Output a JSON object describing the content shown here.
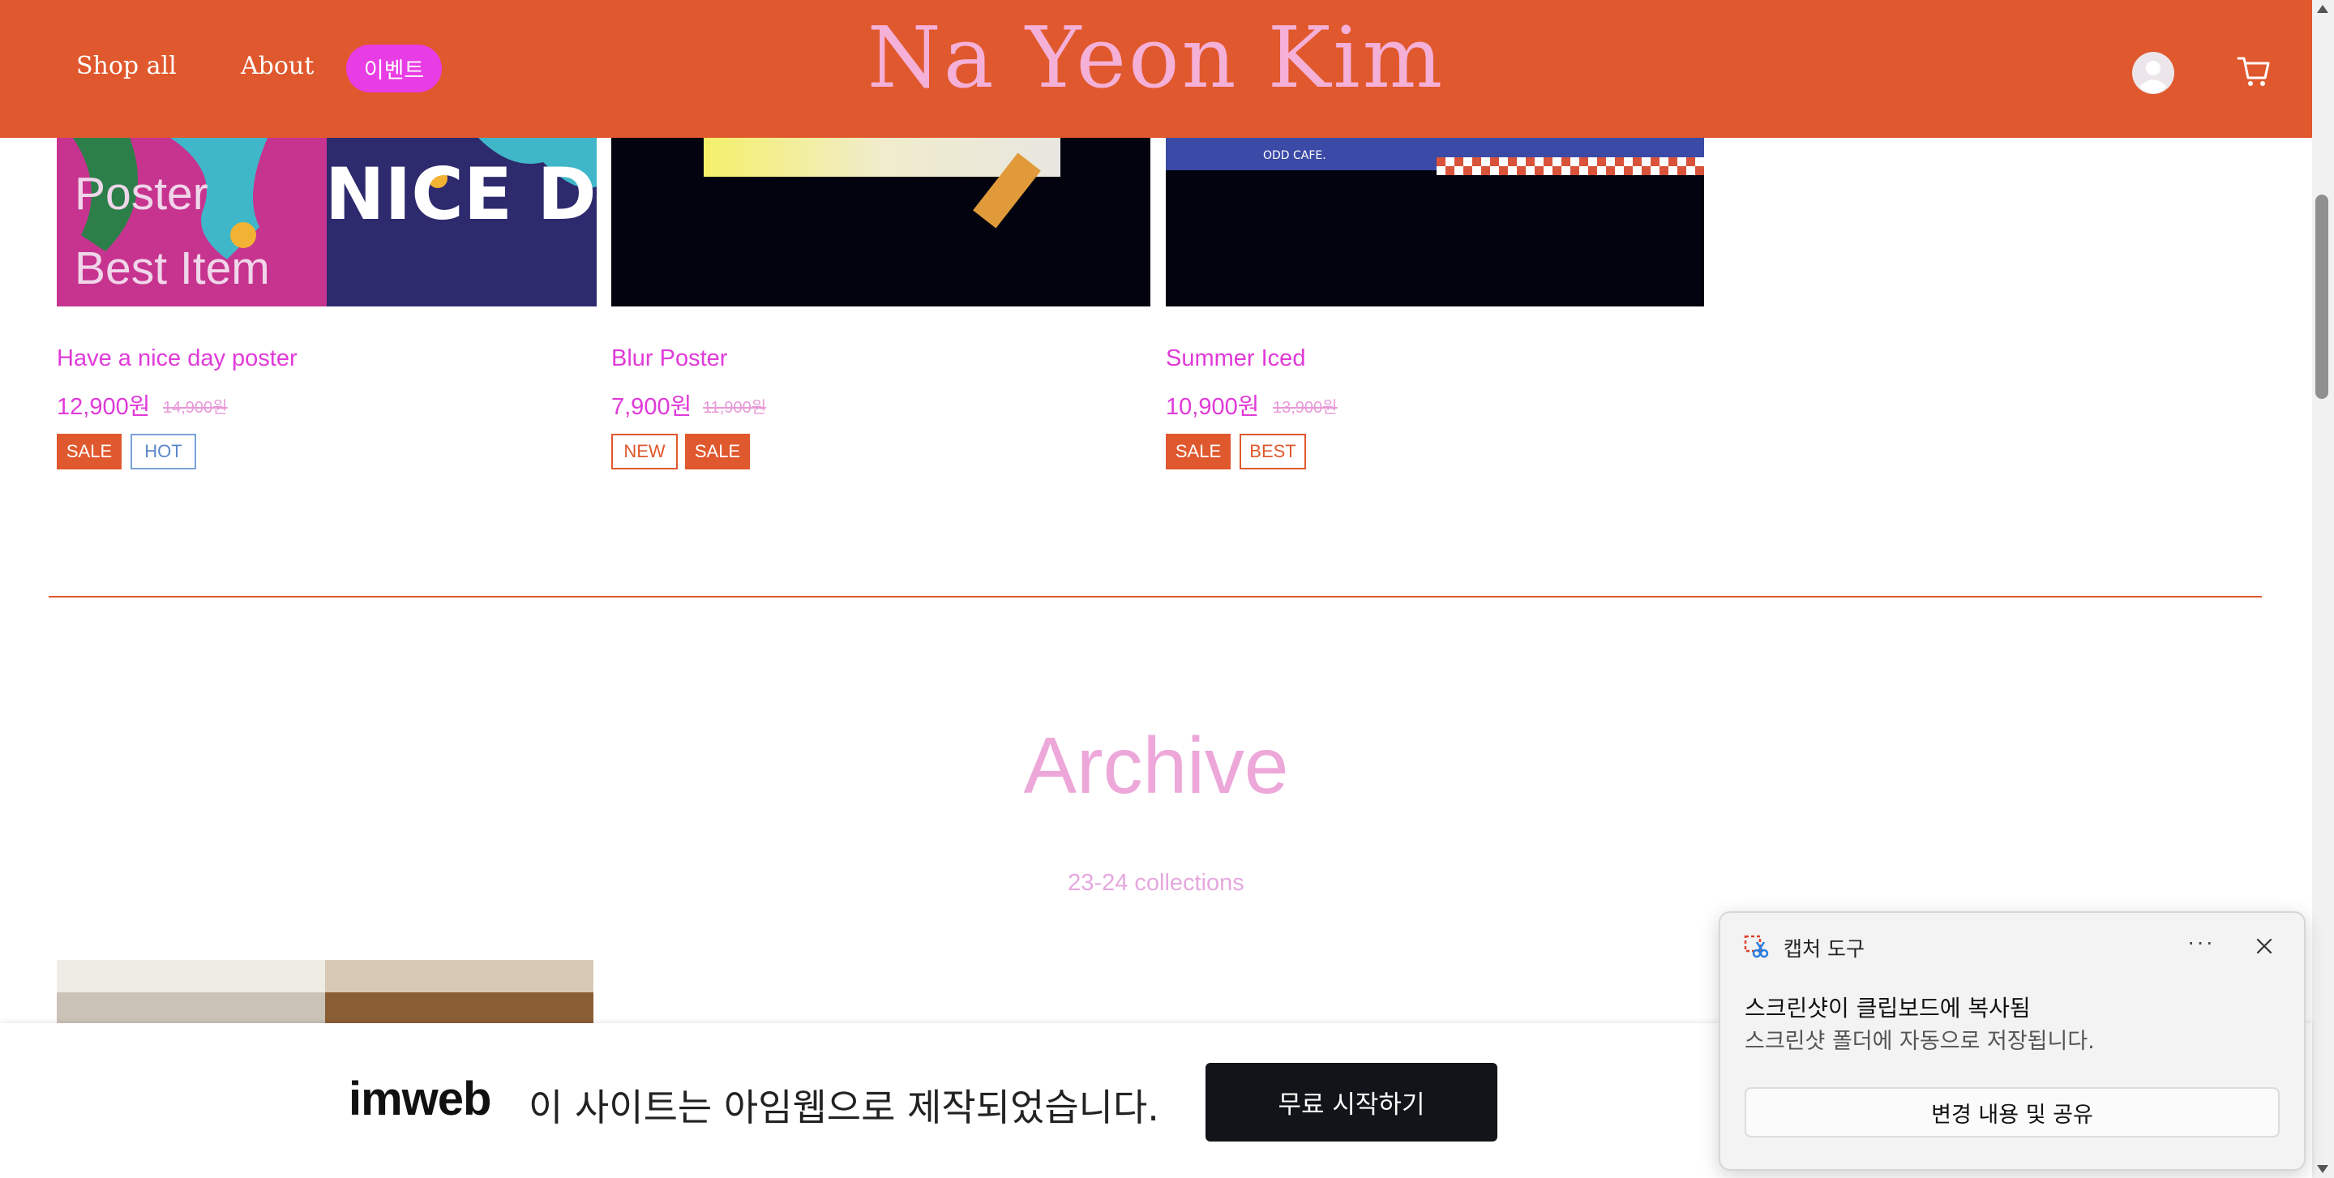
{
  "header": {
    "nav": [
      "Shop all",
      "About"
    ],
    "event_label": "이벤트",
    "logo": "Na Yeon Kim",
    "icons": [
      "user-icon",
      "cart-icon"
    ]
  },
  "products": [
    {
      "name": "Have a nice day poster",
      "price": "12,900원",
      "old_price": "14,900원",
      "badges": [
        "SALE",
        "HOT"
      ],
      "image_overlay": [
        "Poster",
        "Best Item"
      ],
      "image_art_text": "NICE DAY"
    },
    {
      "name": "Blur Poster",
      "price": "7,900원",
      "old_price": "11,900원",
      "badges": [
        "NEW",
        "SALE"
      ]
    },
    {
      "name": "Summer Iced",
      "price": "10,900원",
      "old_price": "13,900원",
      "badges": [
        "SALE",
        "BEST"
      ],
      "image_art_text": "ODD CAFE."
    }
  ],
  "archive": {
    "title": "Archive",
    "subtitle": "23-24 collections"
  },
  "imweb_banner": {
    "logo": "imweb",
    "text": "이 사이트는 아임웹으로 제작되었습니다.",
    "button": "무료 시작하기"
  },
  "toast": {
    "app_name": "캡처 도구",
    "title": "스크린샷이 클립보드에 복사됨",
    "body": "스크린샷 폴더에 자동으로 저장됩니다.",
    "button": "변경 내용 및 공유",
    "more": "···"
  },
  "colors": {
    "brand_orange": "#e0582d",
    "pink_text": "#e03ad8",
    "logo_pink": "#f4b0d7"
  }
}
